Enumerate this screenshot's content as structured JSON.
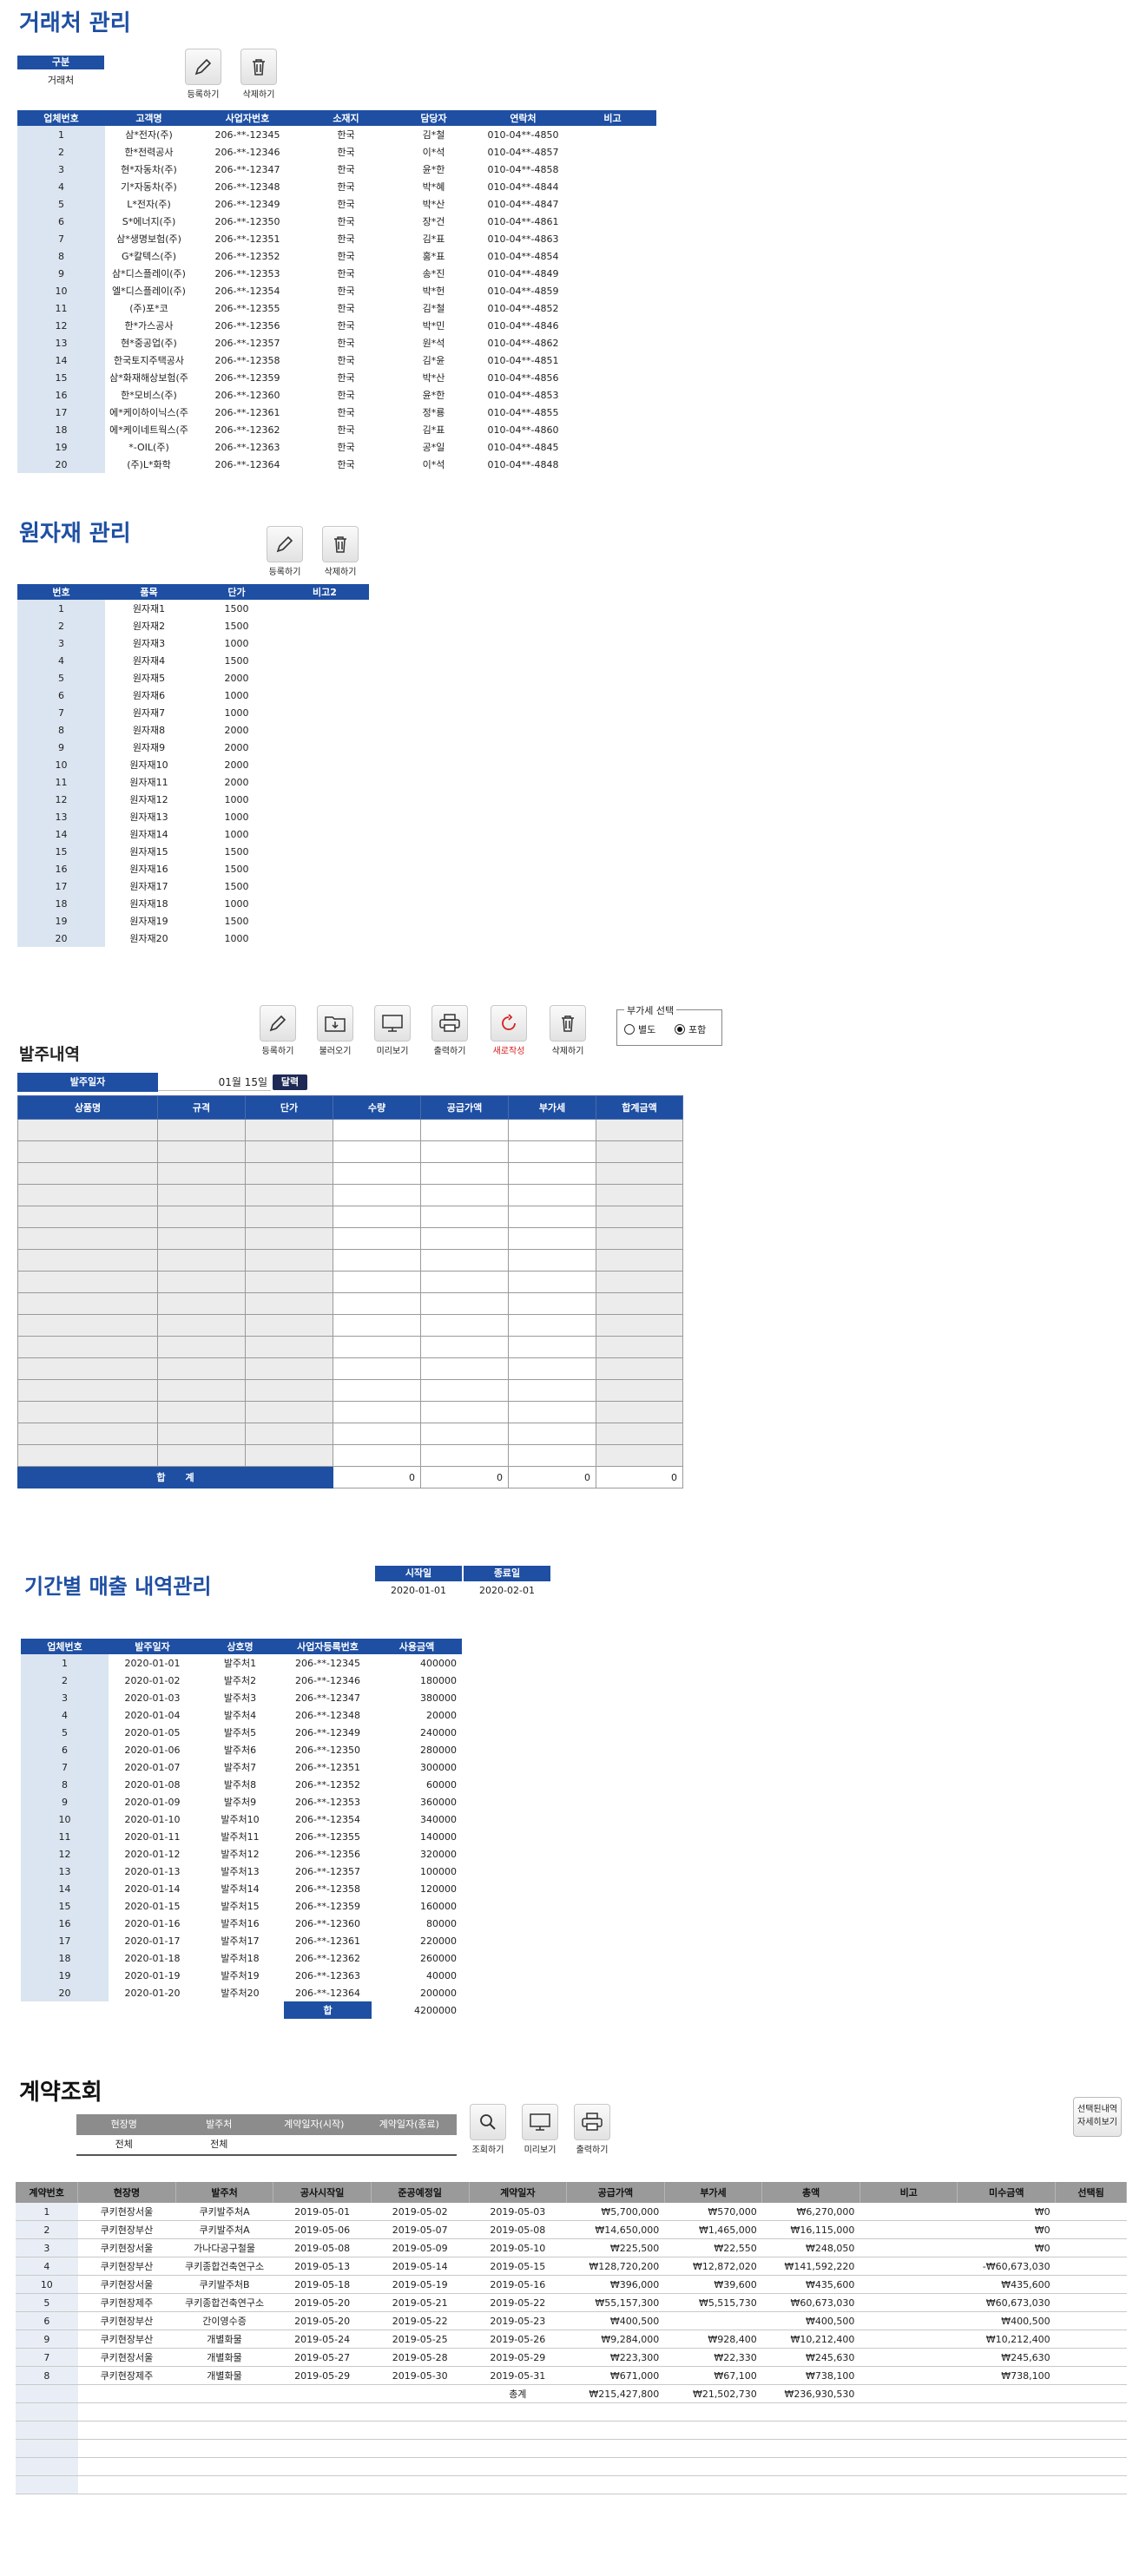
{
  "partners": {
    "title": "거래처 관리",
    "filter_header": "구분",
    "filter_value": "거래처",
    "register_label": "등록하기",
    "delete_label": "삭제하기",
    "columns": [
      "업체번호",
      "고객명",
      "사업자번호",
      "소재지",
      "담당자",
      "연락처",
      "비고"
    ],
    "rows": [
      [
        "1",
        "삼*전자(주)",
        "206-**-12345",
        "한국",
        "김*철",
        "010-04**-4850",
        ""
      ],
      [
        "2",
        "한*전력공사",
        "206-**-12346",
        "한국",
        "이*석",
        "010-04**-4857",
        ""
      ],
      [
        "3",
        "현*자동차(주)",
        "206-**-12347",
        "한국",
        "윤*한",
        "010-04**-4858",
        ""
      ],
      [
        "4",
        "기*자동차(주)",
        "206-**-12348",
        "한국",
        "박*혜",
        "010-04**-4844",
        ""
      ],
      [
        "5",
        "L*전자(주)",
        "206-**-12349",
        "한국",
        "박*산",
        "010-04**-4847",
        ""
      ],
      [
        "6",
        "S*에너지(주)",
        "206-**-12350",
        "한국",
        "장*건",
        "010-04**-4861",
        ""
      ],
      [
        "7",
        "삼*생명보험(주)",
        "206-**-12351",
        "한국",
        "김*표",
        "010-04**-4863",
        ""
      ],
      [
        "8",
        "G*칼텍스(주)",
        "206-**-12352",
        "한국",
        "홍*표",
        "010-04**-4854",
        ""
      ],
      [
        "9",
        "삼*디스플레이(주)",
        "206-**-12353",
        "한국",
        "송*진",
        "010-04**-4849",
        ""
      ],
      [
        "10",
        "엘*디스플레이(주)",
        "206-**-12354",
        "한국",
        "박*헌",
        "010-04**-4859",
        ""
      ],
      [
        "11",
        "(주)포*코",
        "206-**-12355",
        "한국",
        "김*철",
        "010-04**-4852",
        ""
      ],
      [
        "12",
        "한*가스공사",
        "206-**-12356",
        "한국",
        "박*민",
        "010-04**-4846",
        ""
      ],
      [
        "13",
        "현*중공업(주)",
        "206-**-12357",
        "한국",
        "원*석",
        "010-04**-4862",
        ""
      ],
      [
        "14",
        "한국토지주택공사",
        "206-**-12358",
        "한국",
        "김*윤",
        "010-04**-4851",
        ""
      ],
      [
        "15",
        "삼*화재해상보험(주",
        "206-**-12359",
        "한국",
        "박*산",
        "010-04**-4856",
        ""
      ],
      [
        "16",
        "한*모비스(주)",
        "206-**-12360",
        "한국",
        "윤*한",
        "010-04**-4853",
        ""
      ],
      [
        "17",
        "에*케이하이닉스(주",
        "206-**-12361",
        "한국",
        "정*룡",
        "010-04**-4855",
        ""
      ],
      [
        "18",
        "에*케이네트웍스(주",
        "206-**-12362",
        "한국",
        "김*표",
        "010-04**-4860",
        ""
      ],
      [
        "19",
        "*-OIL(주)",
        "206-**-12363",
        "한국",
        "공*일",
        "010-04**-4845",
        ""
      ],
      [
        "20",
        "(주)L*화학",
        "206-**-12364",
        "한국",
        "이*석",
        "010-04**-4848",
        ""
      ]
    ]
  },
  "materials": {
    "title": "원자재 관리",
    "register_label": "등록하기",
    "delete_label": "삭제하기",
    "columns": [
      "번호",
      "품목",
      "단가",
      "비고2"
    ],
    "rows": [
      [
        "1",
        "원자재1",
        "1500",
        ""
      ],
      [
        "2",
        "원자재2",
        "1500",
        ""
      ],
      [
        "3",
        "원자재3",
        "1000",
        ""
      ],
      [
        "4",
        "원자재4",
        "1500",
        ""
      ],
      [
        "5",
        "원자재5",
        "2000",
        ""
      ],
      [
        "6",
        "원자재6",
        "1000",
        ""
      ],
      [
        "7",
        "원자재7",
        "1000",
        ""
      ],
      [
        "8",
        "원자재8",
        "2000",
        ""
      ],
      [
        "9",
        "원자재9",
        "2000",
        ""
      ],
      [
        "10",
        "원자재10",
        "2000",
        ""
      ],
      [
        "11",
        "원자재11",
        "2000",
        ""
      ],
      [
        "12",
        "원자재12",
        "1000",
        ""
      ],
      [
        "13",
        "원자재13",
        "1000",
        ""
      ],
      [
        "14",
        "원자재14",
        "1000",
        ""
      ],
      [
        "15",
        "원자재15",
        "1500",
        ""
      ],
      [
        "16",
        "원자재16",
        "1500",
        ""
      ],
      [
        "17",
        "원자재17",
        "1500",
        ""
      ],
      [
        "18",
        "원자재18",
        "1000",
        ""
      ],
      [
        "19",
        "원자재19",
        "1500",
        ""
      ],
      [
        "20",
        "원자재20",
        "1000",
        ""
      ]
    ]
  },
  "orders": {
    "title": "발주내역",
    "buttons": {
      "register": "등록하기",
      "load": "불러오기",
      "preview": "미리보기",
      "print": "출력하기",
      "new": "새로작성",
      "delete": "삭제하기"
    },
    "vat_group_label": "부가세 선택",
    "vat_options": [
      "별도",
      "포함"
    ],
    "vat_selected": "포함",
    "date_label": "발주일자",
    "date_value": "01월 15일",
    "calendar_button": "달력",
    "columns": [
      "상품명",
      "규격",
      "단가",
      "수량",
      "공급가액",
      "부가세",
      "합계금액"
    ],
    "total_label": "합      계",
    "totals": [
      "0",
      "0",
      "0",
      "0"
    ]
  },
  "sales": {
    "title": "기간별 매출 내역관리",
    "start_label": "시작일",
    "end_label": "종료일",
    "start_value": "2020-01-01",
    "end_value": "2020-02-01",
    "columns": [
      "업체번호",
      "발주일자",
      "상호명",
      "사업자등록번호",
      "사용금액"
    ],
    "rows": [
      [
        "1",
        "2020-01-01",
        "발주처1",
        "206-**-12345",
        "400000"
      ],
      [
        "2",
        "2020-01-02",
        "발주처2",
        "206-**-12346",
        "180000"
      ],
      [
        "3",
        "2020-01-03",
        "발주처3",
        "206-**-12347",
        "380000"
      ],
      [
        "4",
        "2020-01-04",
        "발주처4",
        "206-**-12348",
        "20000"
      ],
      [
        "5",
        "2020-01-05",
        "발주처5",
        "206-**-12349",
        "240000"
      ],
      [
        "6",
        "2020-01-06",
        "발주처6",
        "206-**-12350",
        "280000"
      ],
      [
        "7",
        "2020-01-07",
        "발주처7",
        "206-**-12351",
        "300000"
      ],
      [
        "8",
        "2020-01-08",
        "발주처8",
        "206-**-12352",
        "60000"
      ],
      [
        "9",
        "2020-01-09",
        "발주처9",
        "206-**-12353",
        "360000"
      ],
      [
        "10",
        "2020-01-10",
        "발주처10",
        "206-**-12354",
        "340000"
      ],
      [
        "11",
        "2020-01-11",
        "발주처11",
        "206-**-12355",
        "140000"
      ],
      [
        "12",
        "2020-01-12",
        "발주처12",
        "206-**-12356",
        "320000"
      ],
      [
        "13",
        "2020-01-13",
        "발주처13",
        "206-**-12357",
        "100000"
      ],
      [
        "14",
        "2020-01-14",
        "발주처14",
        "206-**-12358",
        "120000"
      ],
      [
        "15",
        "2020-01-15",
        "발주처15",
        "206-**-12359",
        "160000"
      ],
      [
        "16",
        "2020-01-16",
        "발주처16",
        "206-**-12360",
        "80000"
      ],
      [
        "17",
        "2020-01-17",
        "발주처17",
        "206-**-12361",
        "220000"
      ],
      [
        "18",
        "2020-01-18",
        "발주처18",
        "206-**-12362",
        "260000"
      ],
      [
        "19",
        "2020-01-19",
        "발주처19",
        "206-**-12363",
        "40000"
      ],
      [
        "20",
        "2020-01-20",
        "발주처20",
        "206-**-12364",
        "200000"
      ]
    ],
    "total_label": "합",
    "total_value": "4200000"
  },
  "contracts": {
    "title": "계약조회",
    "filter_columns": [
      "현장명",
      "발주처",
      "계약일자(시작)",
      "계약일자(종료)"
    ],
    "filter_values": [
      "전체",
      "전체",
      "",
      ""
    ],
    "buttons": {
      "search": "조회하기",
      "preview": "미리보기",
      "print": "출력하기"
    },
    "detail_button_lines": [
      "선택된내역",
      "자세히보기"
    ],
    "columns": [
      "계약번호",
      "현장명",
      "발주처",
      "공사시작일",
      "준공예정일",
      "계약일자",
      "공급가액",
      "부가세",
      "총액",
      "비고",
      "미수금액",
      "선택됨"
    ],
    "rows": [
      [
        "1",
        "쿠키현장서울",
        "쿠키발주처A",
        "2019-05-01",
        "2019-05-02",
        "2019-05-03",
        "₩5,700,000",
        "₩570,000",
        "₩6,270,000",
        "",
        "₩0",
        ""
      ],
      [
        "2",
        "쿠키현장부산",
        "쿠키발주처A",
        "2019-05-06",
        "2019-05-07",
        "2019-05-08",
        "₩14,650,000",
        "₩1,465,000",
        "₩16,115,000",
        "",
        "₩0",
        ""
      ],
      [
        "3",
        "쿠키현장서울",
        "가나다공구철물",
        "2019-05-08",
        "2019-05-09",
        "2019-05-10",
        "₩225,500",
        "₩22,550",
        "₩248,050",
        "",
        "₩0",
        ""
      ],
      [
        "4",
        "쿠키현장부산",
        "쿠키종합건축연구소",
        "2019-05-13",
        "2019-05-14",
        "2019-05-15",
        "₩128,720,200",
        "₩12,872,020",
        "₩141,592,220",
        "",
        "-₩60,673,030",
        ""
      ],
      [
        "10",
        "쿠키현장서울",
        "쿠키발주처B",
        "2019-05-18",
        "2019-05-19",
        "2019-05-16",
        "₩396,000",
        "₩39,600",
        "₩435,600",
        "",
        "₩435,600",
        ""
      ],
      [
        "5",
        "쿠키현장제주",
        "쿠키종합건축연구소",
        "2019-05-20",
        "2019-05-21",
        "2019-05-22",
        "₩55,157,300",
        "₩5,515,730",
        "₩60,673,030",
        "",
        "₩60,673,030",
        ""
      ],
      [
        "6",
        "쿠키현장부산",
        "간이영수증",
        "2019-05-20",
        "2019-05-22",
        "2019-05-23",
        "₩400,500",
        "",
        "₩400,500",
        "",
        "₩400,500",
        ""
      ],
      [
        "9",
        "쿠키현장부산",
        "개별화물",
        "2019-05-24",
        "2019-05-25",
        "2019-05-26",
        "₩9,284,000",
        "₩928,400",
        "₩10,212,400",
        "",
        "₩10,212,400",
        ""
      ],
      [
        "7",
        "쿠키현장서울",
        "개별화물",
        "2019-05-27",
        "2019-05-28",
        "2019-05-29",
        "₩223,300",
        "₩22,330",
        "₩245,630",
        "",
        "₩245,630",
        ""
      ],
      [
        "8",
        "쿠키현장제주",
        "개별화물",
        "2019-05-29",
        "2019-05-30",
        "2019-05-31",
        "₩671,000",
        "₩67,100",
        "₩738,100",
        "",
        "₩738,100",
        ""
      ]
    ],
    "total_label": "총계",
    "totals": [
      "₩215,427,800",
      "₩21,502,730",
      "₩236,930,530"
    ]
  }
}
